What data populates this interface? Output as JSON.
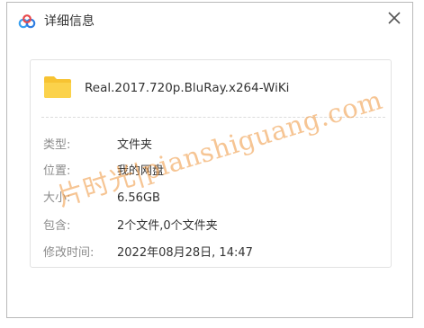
{
  "window": {
    "title": "详细信息",
    "app_icon": "baidu-netdisk-cloud-icon",
    "close_icon": "close-icon"
  },
  "file": {
    "icon": "folder-icon",
    "name": "Real.2017.720p.BluRay.x264-WiKi"
  },
  "details": [
    {
      "label": "类型:",
      "value": "文件夹"
    },
    {
      "label": "位置:",
      "value": "我的网盘"
    },
    {
      "label": "大小:",
      "value": "6.56GB"
    },
    {
      "label": "包含:",
      "value": "2个文件,0个文件夹"
    },
    {
      "label": "修改时间:",
      "value": "2022年08月28日, 14:47"
    }
  ],
  "watermark": "片时光|pianshiguang.com",
  "colors": {
    "folder": "#f7c332",
    "label": "#8c8c8c",
    "value": "#333333",
    "watermark": "#ee963c"
  }
}
